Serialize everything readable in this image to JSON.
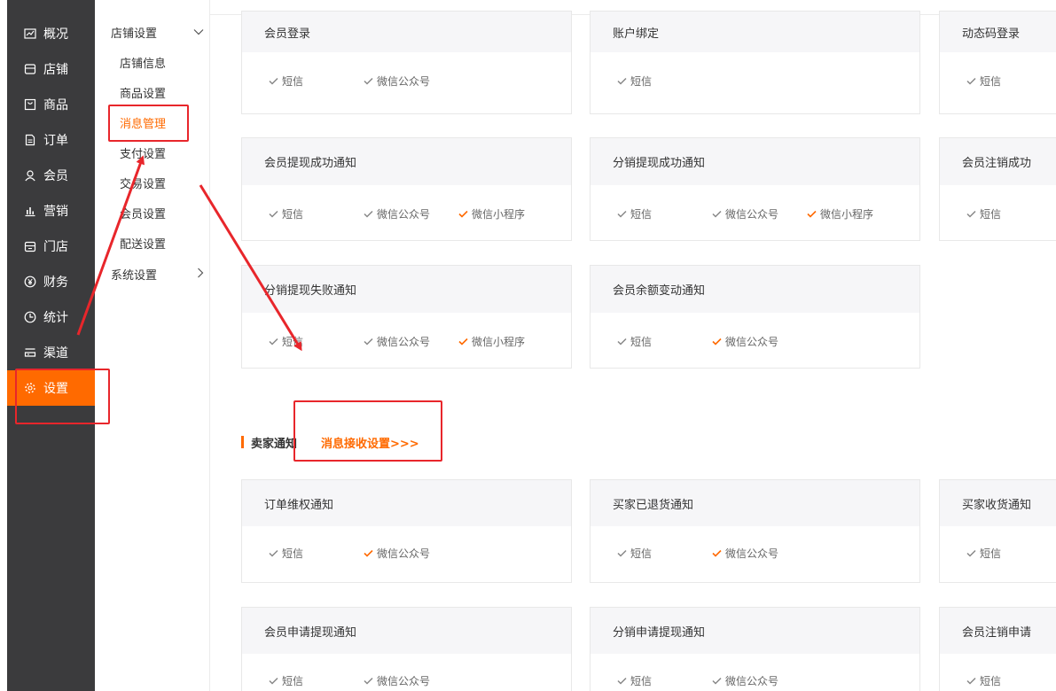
{
  "nav": {
    "items": [
      {
        "label": "概况",
        "icon": "chart-icon"
      },
      {
        "label": "店铺",
        "icon": "store-icon"
      },
      {
        "label": "商品",
        "icon": "goods-icon"
      },
      {
        "label": "订单",
        "icon": "order-icon"
      },
      {
        "label": "会员",
        "icon": "user-icon"
      },
      {
        "label": "营销",
        "icon": "bar-chart-icon"
      },
      {
        "label": "门店",
        "icon": "shop-icon"
      },
      {
        "label": "财务",
        "icon": "yuan-icon"
      },
      {
        "label": "统计",
        "icon": "pie-icon"
      },
      {
        "label": "渠道",
        "icon": "channel-icon"
      },
      {
        "label": "设置",
        "icon": "gear-icon",
        "active": true
      }
    ]
  },
  "submenu": {
    "group_store": "店铺设置",
    "items": [
      "店铺信息",
      "商品设置",
      "消息管理",
      "支付设置",
      "交易设置",
      "会员设置",
      "配送设置"
    ],
    "group_system": "系统设置"
  },
  "options": {
    "sms": "短信",
    "wechat_mp": "微信公众号",
    "wechat_mini": "微信小程序"
  },
  "buyer_cards": [
    {
      "title": "会员登录",
      "options": [
        "短信",
        "微信公众号"
      ],
      "checked": [
        false,
        false
      ]
    },
    {
      "title": "账户绑定",
      "options": [
        "短信"
      ],
      "checked": [
        false
      ]
    },
    {
      "title": "动态码登录",
      "options": [
        "短信"
      ],
      "checked": [
        false
      ]
    },
    {
      "title": "会员提现成功通知",
      "options": [
        "短信",
        "微信公众号",
        "微信小程序"
      ],
      "checked": [
        false,
        false,
        true
      ]
    },
    {
      "title": "分销提现成功通知",
      "options": [
        "短信",
        "微信公众号",
        "微信小程序"
      ],
      "checked": [
        false,
        false,
        true
      ]
    },
    {
      "title": "会员注销成功",
      "options": [
        "短信"
      ],
      "checked": [
        false
      ]
    },
    {
      "title": "分销提现失败通知",
      "options": [
        "短信",
        "微信公众号",
        "微信小程序"
      ],
      "checked": [
        false,
        false,
        true
      ]
    },
    {
      "title": "会员余额变动通知",
      "options": [
        "短信",
        "微信公众号"
      ],
      "checked": [
        false,
        true
      ]
    }
  ],
  "seller_section": {
    "title": "卖家通知",
    "link": "消息接收设置>>>"
  },
  "seller_cards": [
    {
      "title": "订单维权通知",
      "options": [
        "短信",
        "微信公众号"
      ],
      "checked": [
        false,
        true
      ]
    },
    {
      "title": "买家已退货通知",
      "options": [
        "短信",
        "微信公众号"
      ],
      "checked": [
        false,
        true
      ]
    },
    {
      "title": "买家收货通知",
      "options": [
        "短信"
      ],
      "checked": [
        false
      ]
    },
    {
      "title": "会员申请提现通知",
      "options": [
        "短信",
        "微信公众号"
      ],
      "checked": [
        false,
        false
      ]
    },
    {
      "title": "分销申请提现通知",
      "options": [
        "短信",
        "微信公众号"
      ],
      "checked": [
        false,
        false
      ]
    },
    {
      "title": "会员注销申请",
      "options": [
        "短信"
      ],
      "checked": [
        false
      ]
    }
  ],
  "colors": {
    "accent": "#ff6a00",
    "annotation": "#e8262b",
    "nav_bg": "#3b3b3d",
    "check_gray": "#888888"
  }
}
